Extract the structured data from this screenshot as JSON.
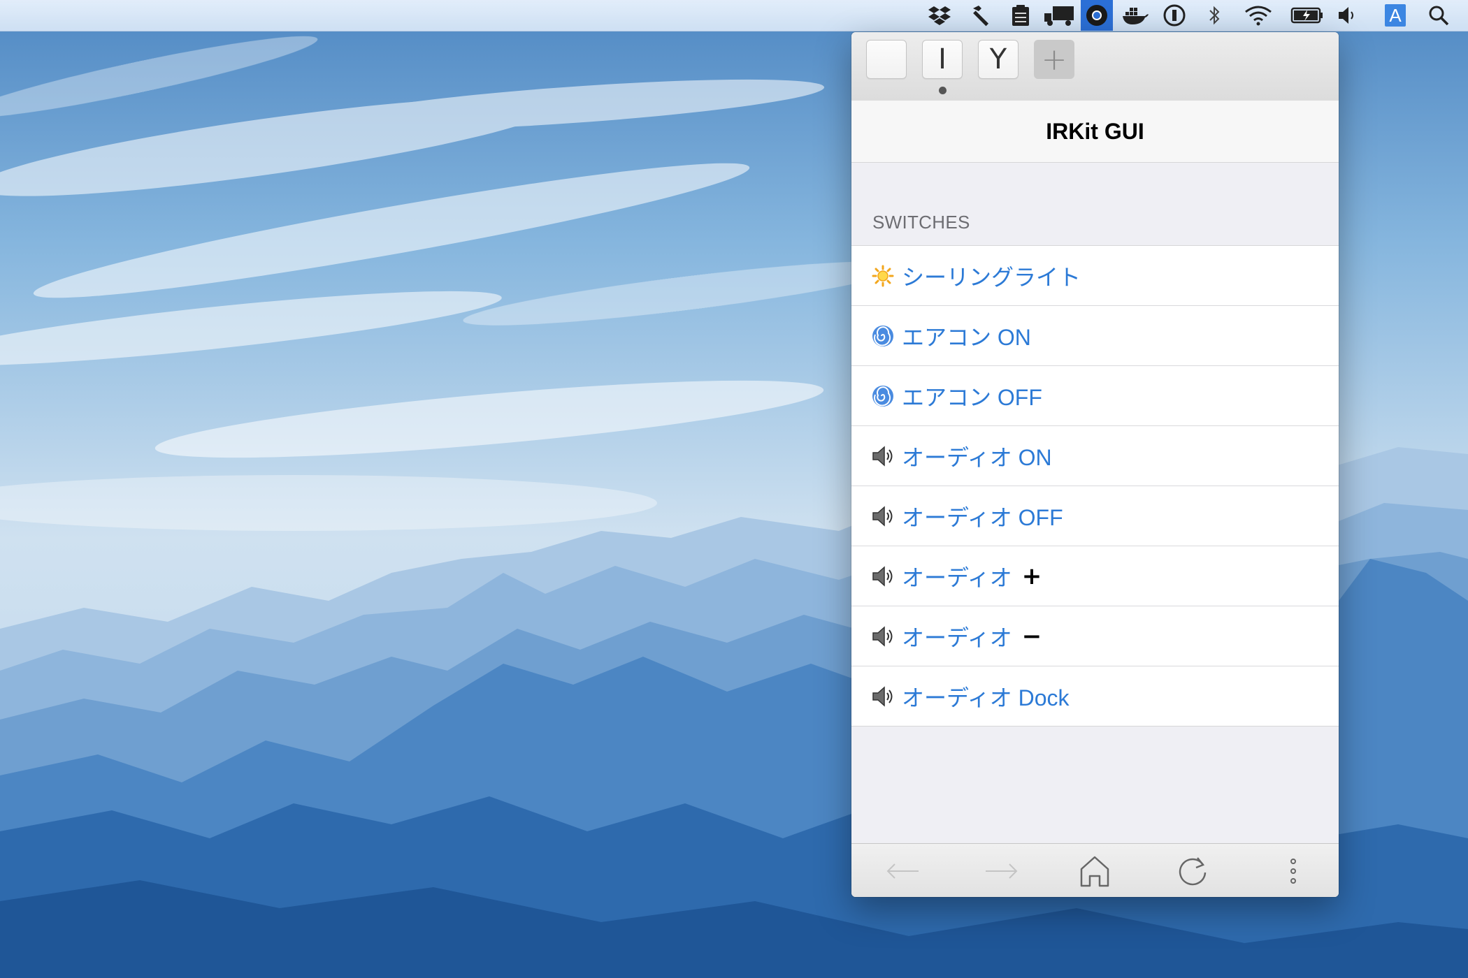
{
  "menubar": {
    "icons": [
      "dropbox-icon",
      "hammer-icon",
      "clipboard-icon",
      "truck-icon",
      "chrome-icon",
      "docker-icon",
      "onepassword-icon",
      "bluetooth-icon",
      "wifi-icon",
      "battery-icon",
      "volume-icon",
      "input-source-icon",
      "spotlight-icon"
    ],
    "input_source_label": "A"
  },
  "popover": {
    "tabs": [
      {
        "label": ""
      },
      {
        "label": "I"
      },
      {
        "label": "Y"
      },
      {
        "label": "+"
      }
    ],
    "title": "IRKit GUI",
    "section_header": "SWITCHES",
    "items": [
      {
        "icon": "sun-icon",
        "label": "シーリングライト",
        "suffix": ""
      },
      {
        "icon": "cyclone-icon",
        "label": "エアコン ON",
        "suffix": ""
      },
      {
        "icon": "cyclone-icon",
        "label": "エアコン OFF",
        "suffix": ""
      },
      {
        "icon": "speaker-icon",
        "label": "オーディオ ON",
        "suffix": ""
      },
      {
        "icon": "speaker-icon",
        "label": "オーディオ OFF",
        "suffix": ""
      },
      {
        "icon": "speaker-icon",
        "label": "オーディオ",
        "suffix": "+"
      },
      {
        "icon": "speaker-icon",
        "label": "オーディオ",
        "suffix": "−"
      },
      {
        "icon": "speaker-icon",
        "label": "オーディオ Dock",
        "suffix": ""
      }
    ],
    "bottom_bar": [
      "back-arrow-icon",
      "forward-arrow-icon",
      "home-icon",
      "reload-icon",
      "more-icon"
    ]
  },
  "colors": {
    "link_blue": "#2c7ad6",
    "menubar_active": "#2b6fd6"
  }
}
